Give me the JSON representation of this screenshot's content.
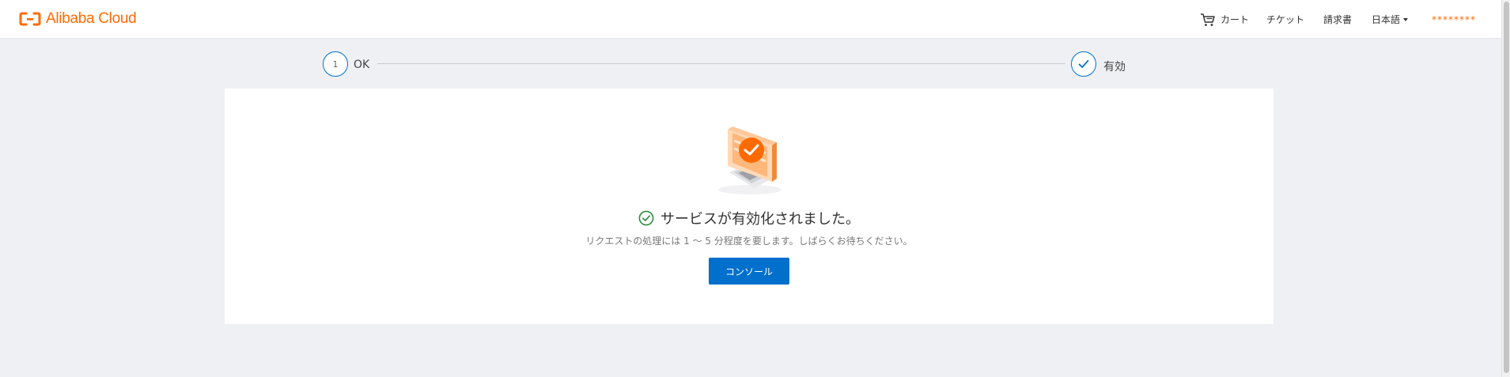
{
  "header": {
    "logo_text": "Alibaba Cloud",
    "nav": {
      "cart_label": "カート",
      "ticket_label": "チケット",
      "billing_label": "請求書",
      "language_label": "日本語",
      "user_label": "********"
    }
  },
  "steps": [
    {
      "number": "1",
      "label": "OK",
      "state": "done"
    },
    {
      "label": "有効",
      "state": "done",
      "icon": "check-icon"
    }
  ],
  "result": {
    "title": "サービスが有効化されました。",
    "subtitle": "リクエストの処理には 1 ～ 5 分程度を要します。しばらくお待ちください。",
    "button_label": "コンソール",
    "icon": "success-check-icon"
  },
  "colors": {
    "brand": "#ff6a00",
    "primary": "#0070cc",
    "success": "#2e8b3c",
    "page_bg": "#eff0f4"
  }
}
